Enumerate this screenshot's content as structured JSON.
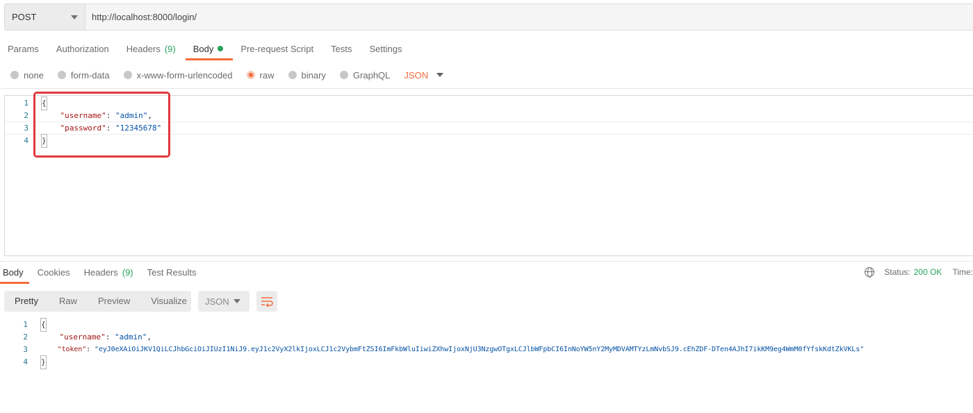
{
  "request": {
    "method": "POST",
    "url": "http://localhost:8000/login/"
  },
  "request_tabs": [
    {
      "label": "Params"
    },
    {
      "label": "Authorization"
    },
    {
      "label": "Headers",
      "count": "(9)"
    },
    {
      "label": "Body",
      "active": true
    },
    {
      "label": "Pre-request Script"
    },
    {
      "label": "Tests"
    },
    {
      "label": "Settings"
    }
  ],
  "body_types": [
    {
      "label": "none"
    },
    {
      "label": "form-data"
    },
    {
      "label": "x-www-form-urlencoded"
    },
    {
      "label": "raw",
      "selected": true
    },
    {
      "label": "binary"
    },
    {
      "label": "GraphQL"
    }
  ],
  "body_format": "JSON",
  "request_body": {
    "line_numbers": [
      "1",
      "2",
      "3",
      "4"
    ],
    "open_brace": "{",
    "close_brace": "}",
    "username_key": "\"username\"",
    "username_value": "\"admin\"",
    "password_key": "\"password\"",
    "password_value": "\"12345678\""
  },
  "response_tabs": [
    {
      "label": "Body",
      "active": true
    },
    {
      "label": "Cookies"
    },
    {
      "label": "Headers",
      "count": "(9)"
    },
    {
      "label": "Test Results"
    }
  ],
  "status": {
    "label": "Status:",
    "value": "200 OK",
    "time_label": "Time:"
  },
  "view_modes": [
    "Pretty",
    "Raw",
    "Preview",
    "Visualize"
  ],
  "response_format": "JSON",
  "response_body": {
    "line_numbers": [
      "1",
      "2",
      "3",
      "4"
    ],
    "open_brace": "{",
    "close_brace": "}",
    "username_key": "\"username\"",
    "username_value": "\"admin\"",
    "token_key": "\"token\"",
    "token_value": "\"eyJ0eXAiOiJKV1QiLCJhbGciOiJIUzI1NiJ9.eyJ1c2VyX2lkIjoxLCJ1c2VybmFtZSI6ImFkbWluIiwiZXhwIjoxNjU3NzgwOTgxLCJlbWFpbCI6InNoYW5nY2MyMDVAMTYzLmNvbSJ9.cEhZDF-DTen4AJhI7ikKM9eg4WmM0fYfskKdtZkVKLs\""
  },
  "colors": {
    "accent": "#f26b3a",
    "success": "#26a35a",
    "highlight_box": "#e0393e"
  }
}
